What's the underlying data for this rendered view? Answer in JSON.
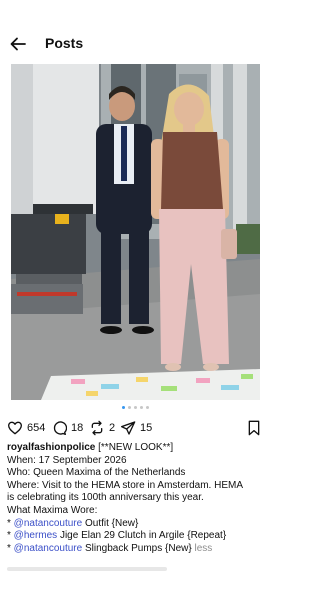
{
  "header": {
    "title": "Posts",
    "back_icon": "arrow-left-icon"
  },
  "post": {
    "carousel": {
      "count": 5,
      "active_index": 0
    },
    "stats": {
      "likes": "654",
      "comments": "18",
      "reposts": "2",
      "shares": "15"
    },
    "caption": {
      "username": "royalfashionpolice",
      "headline": "[**NEW LOOK**]",
      "when": "When: 17 September 2026",
      "who": "Who: Queen Maxima of the Netherlands",
      "where_1": "Where: Visit to the HEMA store in Amsterdam. HEMA",
      "where_2": "is celebrating its 100th anniversary this year.",
      "what_wore": "What Maxima Wore:",
      "items": [
        {
          "bullet": "* ",
          "mention": "@natancouture",
          "text": " Outfit {New}"
        },
        {
          "bullet": "* ",
          "mention": "@hermes",
          "text": " Jige Elan 29 Clutch in Argile {Repeat}"
        },
        {
          "bullet": "* ",
          "mention": "@natancouture",
          "text": " Slingback Pumps {New} ",
          "more": "less"
        }
      ]
    }
  },
  "colors": {
    "accent": "#3897f0",
    "mention": "#3c50c8",
    "muted": "#8e8e8e"
  }
}
